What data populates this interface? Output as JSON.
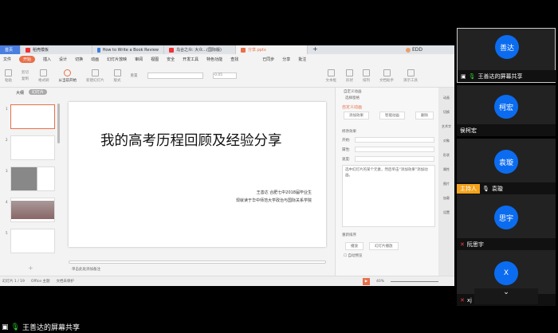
{
  "wps": {
    "tabs": [
      "首页",
      "稻壳模板",
      "How to Write a Book Review",
      "乌合之众: 大众...(国际版)",
      "分享.pptx"
    ],
    "user": "EDD",
    "menu": [
      "文件",
      "开始",
      "插入",
      "设计",
      "切换",
      "动画",
      "幻灯片放映",
      "审阅",
      "视图",
      "安全",
      "开发工具",
      "特色功能",
      "查找"
    ],
    "menu_right": [
      "已同步",
      "分享",
      "批注"
    ],
    "toolbar": [
      "粘贴",
      "剪切",
      "复制",
      "格式刷",
      "从当前开始",
      "新建幻灯片",
      "版式",
      "重置",
      "文本框",
      "形状",
      "排列",
      "文档助手",
      "演示工具"
    ],
    "font_size": "-0.05",
    "left_tabs": [
      "大纲",
      "幻灯片"
    ],
    "slide": {
      "title": "我的高考历程回顾及经验分享",
      "sub1": "王善达 合肥七中2018届毕业生",
      "sub2": "现就读于华中师范大学政治与国际关系学院"
    },
    "notes": "单击此处添加备注",
    "pane": {
      "header": "自定义动画",
      "select": "选择窗格",
      "section": "自定义动画",
      "add": "添加效果",
      "smart": "智能动画",
      "delete": "删除",
      "modify": "修改效果",
      "start": "开始:",
      "prop": "属性:",
      "speed": "速度:",
      "hint": "选中幻灯片的某个元素，然后单击“添加效果”添加动画。",
      "reorder": "重新排序",
      "play": "播放",
      "slideshow": "幻灯片播放",
      "autopreview": "自动预览"
    },
    "side": [
      "动画",
      "切换",
      "艺术字",
      "对象",
      "形状",
      "属性",
      "图片",
      "加载",
      "设置"
    ],
    "status": {
      "slide": "幻灯片 1 / 19",
      "theme": "Office 主题",
      "protect": "文档未保护",
      "zoom": "40%"
    }
  },
  "participants": [
    {
      "avatar": "善达",
      "name": "王善达的屏幕共享",
      "mic": "on",
      "sharing": true
    },
    {
      "avatar": "柯宏",
      "name": "侯柯宏"
    },
    {
      "avatar": "袁璇",
      "name": "袁璇",
      "host_label": "主持人",
      "mic": "on"
    },
    {
      "avatar": "思宇",
      "name": "阮思宇",
      "mic": "muted"
    },
    {
      "avatar": "X",
      "name": "xj",
      "mic": "muted"
    }
  ],
  "bottom_label": "王善达的屏幕共享",
  "colors": {
    "avatar": "#0b6cf0",
    "host": "#f3a21b",
    "wps_accent": "#e8704a"
  }
}
